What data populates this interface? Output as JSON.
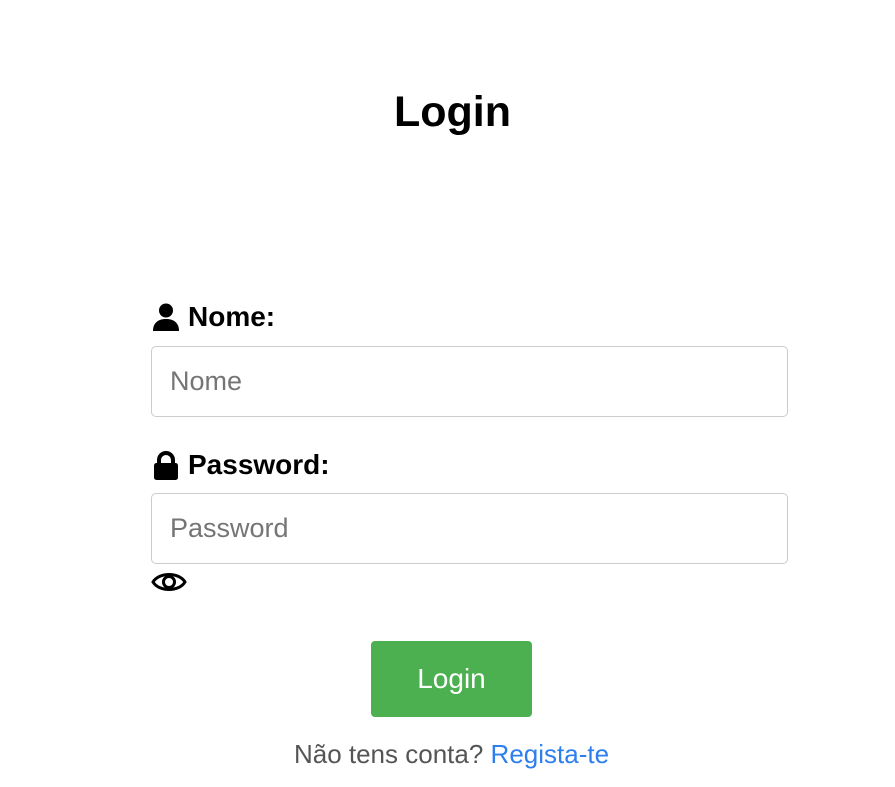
{
  "page": {
    "title": "Login"
  },
  "form": {
    "nome": {
      "label": "Nome:",
      "placeholder": "Nome",
      "icon": "user-icon"
    },
    "password": {
      "label": "Password:",
      "placeholder": "Password",
      "icon": "lock-icon",
      "toggle_icon": "eye-icon"
    },
    "submit_label": "Login"
  },
  "signup": {
    "prompt": "Não tens conta?",
    "link_label": "Regista-te"
  },
  "colors": {
    "button_background": "#4caf50",
    "button_text": "#ffffff",
    "link": "#2d7ff0",
    "muted_text": "#555555",
    "input_border": "#cccccc"
  }
}
